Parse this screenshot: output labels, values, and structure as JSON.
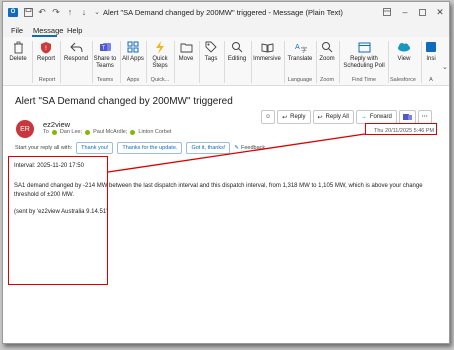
{
  "window": {
    "app_icon_label": "O",
    "title": "Alert \"SA Demand changed by 200MW\" triggered  -  Message (Plain Text)"
  },
  "menu": {
    "tabs": [
      "File",
      "Message",
      "Help"
    ]
  },
  "ribbon": {
    "buttons": {
      "delete": "Delete",
      "report": "Report",
      "respond": "Respond",
      "share": "Share to Teams",
      "all_apps": "All Apps",
      "quick_steps": "Quick Steps",
      "move": "Move",
      "tags": "Tags",
      "editing": "Editing",
      "immersive": "Immersive",
      "translate": "Translate",
      "zoom": "Zoom",
      "reply_poll": "Reply with Scheduling Poll",
      "view": "View",
      "insights": "Insi"
    },
    "groups": {
      "report": "Report",
      "teams": "Teams",
      "apps": "Apps",
      "quick": "Quick...",
      "language": "Language",
      "zoom": "Zoom",
      "find_time": "Find Time",
      "salesforce": "Salesforce",
      "a": "A"
    }
  },
  "message": {
    "subject": "Alert \"SA Demand changed by 200MW\" triggered",
    "avatar_initials": "ER",
    "sender": "ez2view",
    "to_label": "To",
    "recipients": [
      "Dan Lee;",
      "Paul McArdle;",
      "Linton Corbet"
    ],
    "datetime": "Thu 20/11/2025 5:46 PM",
    "actions": {
      "reply": "Reply",
      "reply_all": "Reply All",
      "forward": "Forward"
    }
  },
  "quick_replies": {
    "prompt": "Start your reply all with:",
    "options": [
      "Thank you!",
      "Thanks for the update.",
      "Got it, thanks!"
    ],
    "feedback": "Feedback"
  },
  "body": {
    "interval": "Interval: 2025-11-20 17:50",
    "line1": "SA1 demand changed by -214 MW between the last dispatch interval and this dispatch interval, from 1,318 MW to 1,105 MW, which is above your change",
    "line2": "threshold of ±200 MW.",
    "line3": "(sent by 'ez2view Australia 9.14.51'"
  }
}
